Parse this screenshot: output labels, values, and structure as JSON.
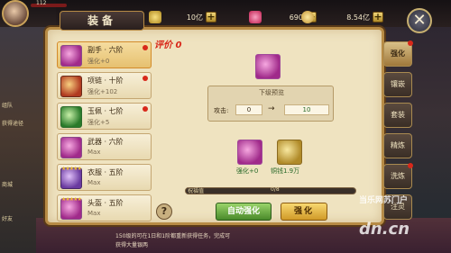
{
  "hud": {
    "level_text": "112",
    "resources": [
      {
        "value": "10亿",
        "color": "#f0c040",
        "icon": "ingot-icon"
      },
      {
        "value": "690",
        "color": "#e04060",
        "icon": "gem-icon"
      },
      {
        "value": "8.54亿",
        "color": "#f0c040",
        "icon": "coin-icon"
      }
    ]
  },
  "panel": {
    "title": "装备",
    "score_label": "评价 0"
  },
  "equipment": [
    {
      "name": "副手 · 六阶",
      "sub": "强化+0",
      "color": "#a02a8a",
      "selected": true,
      "dot": true
    },
    {
      "name": "项链 · 十阶",
      "sub": "强化+102",
      "color": "#b03a20",
      "selected": false,
      "dot": true
    },
    {
      "name": "玉佩 · 七阶",
      "sub": "强化+5",
      "color": "#2a7a2a",
      "selected": false,
      "dot": true
    },
    {
      "name": "武器 · 六阶",
      "sub": "Max",
      "color": "#a02a8a",
      "selected": false,
      "dot": false
    },
    {
      "name": "衣服 · 五阶",
      "sub": "Max",
      "color": "#6a3aa0",
      "selected": false,
      "dot": false,
      "stars": "★★★★★"
    },
    {
      "name": "头盔 · 五阶",
      "sub": "Max",
      "color": "#a02a8a",
      "selected": false,
      "dot": false,
      "stars": "★★★★★"
    }
  ],
  "preview": {
    "title": "下级预览",
    "attr_label": "攻击:",
    "from_value": "0",
    "arrow": "→",
    "to_value": "10"
  },
  "materials": [
    {
      "label": "强化+0",
      "icon": "equipment-icon"
    },
    {
      "label": "铜钱1.9万",
      "icon": "copper-coin-icon"
    }
  ],
  "bless": {
    "label": "祝福值",
    "count": "0/8"
  },
  "buttons": {
    "help": "?",
    "auto": "自动强化",
    "enhance": "强化"
  },
  "tabs": [
    {
      "label": "强化",
      "active": true,
      "dot": true
    },
    {
      "label": "镶嵌",
      "active": false,
      "dot": false
    },
    {
      "label": "套装",
      "active": false,
      "dot": false
    },
    {
      "label": "精炼",
      "active": false,
      "dot": false
    },
    {
      "label": "洗炼",
      "active": false,
      "dot": true
    },
    {
      "label": "注灵",
      "active": false,
      "dot": false
    }
  ],
  "side_texts": [
    "组队",
    "获得途径",
    "商城",
    "好友"
  ],
  "chat": [
    "150级的可在1日和1阶都重新获得任务，完成可",
    "获得大量银两"
  ],
  "watermark": {
    "line1": "当乐网苏门户",
    "line2": "dn.cn"
  }
}
